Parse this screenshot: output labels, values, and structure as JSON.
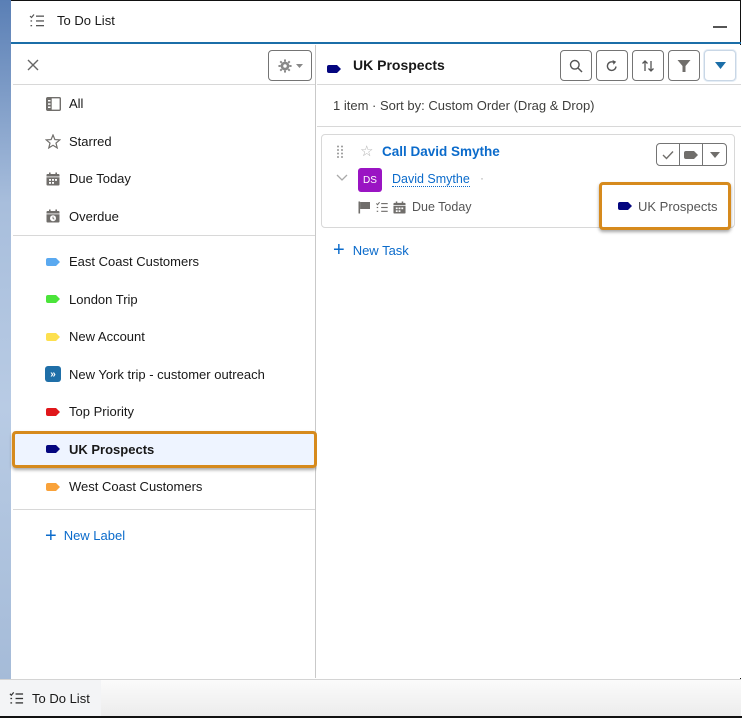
{
  "window": {
    "title": "To Do List",
    "minimize_label": "Minimize"
  },
  "left_panel": {
    "close_label": "Close",
    "settings_label": "Settings",
    "views": [
      {
        "label": "All",
        "icon": "list-view-icon"
      },
      {
        "label": "Starred",
        "icon": "star-icon"
      },
      {
        "label": "Due Today",
        "icon": "calendar-icon"
      },
      {
        "label": "Overdue",
        "icon": "calendar-clock-icon"
      }
    ],
    "labels": [
      {
        "label": "East Coast Customers",
        "color": "#5aa9f0"
      },
      {
        "label": "London Trip",
        "color": "#4be43a"
      },
      {
        "label": "New Account",
        "color": "#fde04f"
      },
      {
        "label": "New York trip - customer outreach",
        "color": "#1f6fa8",
        "icon": "forward-icon"
      },
      {
        "label": "Top Priority",
        "color": "#e0171b"
      },
      {
        "label": "UK Prospects",
        "color": "#04067f",
        "selected": true
      },
      {
        "label": "West Coast Customers",
        "color": "#f9a23a"
      }
    ],
    "new_label": "New Label"
  },
  "right_panel": {
    "header": {
      "title": "UK Prospects",
      "tag_color": "#04067f",
      "tools": [
        "search",
        "refresh",
        "sort",
        "filter",
        "more"
      ]
    },
    "summary": "1 item · Sort by: Custom Order (Drag & Drop)",
    "tasks": [
      {
        "title": "Call David Smythe",
        "starred": false,
        "contact_initials": "DS",
        "contact_name": "David Smythe",
        "avatar_color": "#9a14c3",
        "due": "Due Today",
        "label": "UK Prospects",
        "label_color": "#04067f"
      }
    ],
    "new_task": "New Task"
  },
  "utility_bar": {
    "tab_label": "To Do List"
  },
  "colors": {
    "accent": "#0b6bcb",
    "highlight": "#d68a1d",
    "title_underline": "#1b6ea8"
  }
}
